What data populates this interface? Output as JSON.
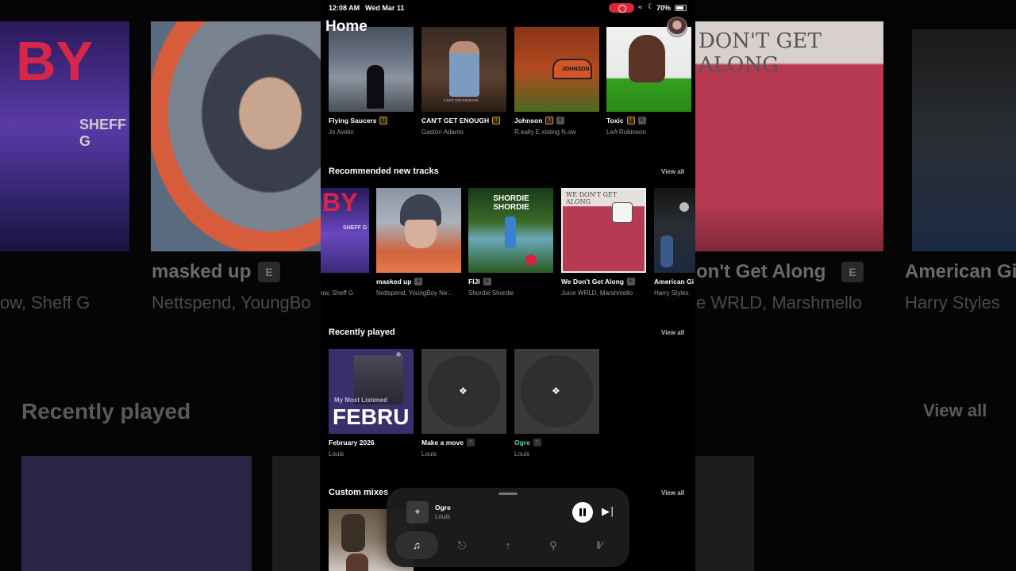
{
  "status_bar": {
    "time": "12:08 AM",
    "date": "Wed Mar 11",
    "battery": "70%"
  },
  "page": {
    "title": "Home"
  },
  "top_row": [
    {
      "title": "Flying Saucers",
      "artist": "Jo Avelin",
      "badges": [
        "up"
      ]
    },
    {
      "title": "CAN'T GET ENOUGH",
      "artist": "Gastón Adanto",
      "badges": [
        "up"
      ],
      "art_text": "CAN'T GET ENOUGH"
    },
    {
      "title": "Johnson",
      "artist": "R.eally E.xisting N.ow",
      "badges": [
        "up",
        "e"
      ],
      "art_text": "JOHNSON"
    },
    {
      "title": "Toxic",
      "artist": "LeA Robinson",
      "badges": [
        "up",
        "e"
      ]
    }
  ],
  "recommended": {
    "title": "Recommended new tracks",
    "view_all": "View all",
    "items": [
      {
        "title": "",
        "artist": "ow, Sheff G",
        "art_text": "BY",
        "art_sub": "SHEFF G"
      },
      {
        "title": "masked up",
        "artist": "Nettspend, YoungBoy Ne...",
        "badges": [
          "e"
        ]
      },
      {
        "title": "FIJI",
        "artist": "Shordie Shordie",
        "badges": [
          "e"
        ],
        "art_text": "SHORDIE SHORDIE"
      },
      {
        "title": "We Don't Get Along",
        "artist": "Juice WRLD, Marshmello",
        "badges": [
          "e"
        ],
        "art_text": "WE DON'T GET ALONG"
      },
      {
        "title": "American Gi",
        "artist": "Harry Styles",
        "badges": []
      }
    ]
  },
  "recently_played": {
    "title": "Recently played",
    "view_all": "View all",
    "items": [
      {
        "title": "February 2026",
        "artist": "Louis",
        "art_caption": "My Most Listened",
        "art_big": "FEBRU"
      },
      {
        "title": "Make a move",
        "artist": "Louis",
        "badges": [
          "up-grey"
        ]
      },
      {
        "title": "Ogre",
        "artist": "Louis",
        "badges": [
          "up-grey"
        ],
        "playing": true
      }
    ]
  },
  "custom_mixes": {
    "title": "Custom mixes",
    "view_all": "View all"
  },
  "now_playing": {
    "title": "Ogre",
    "artist": "Louis"
  },
  "background": {
    "left_sub": "ow, Sheff G",
    "left_art_text": "BY",
    "left_art_sub": "SHEFF G",
    "masked_up": "masked up",
    "masked_sub": "Nettspend, YoungBo",
    "along": "on't Get Along",
    "along_sub": "e WRLD, Marshmello",
    "american": "American Gi",
    "american_sub": "Harry Styles",
    "recent": "Recently played",
    "view_all": "View all",
    "getalong_art": "DON'T GET ALONG",
    "e_badge": "E"
  },
  "colors": {
    "accent_green": "#5ed6a4",
    "explicit_up": "#e8c15a",
    "record": "#e0243a"
  }
}
